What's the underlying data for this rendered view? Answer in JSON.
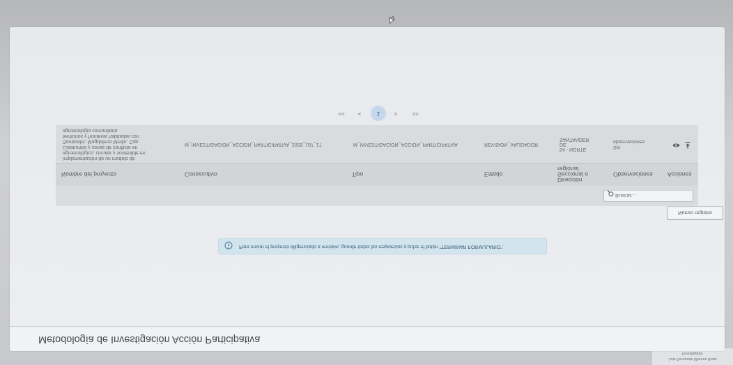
{
  "header": {
    "title": "Metodología de Investigación Acción Participativa"
  },
  "user_box": {
    "name": "Luis Fernando Moreno Arias",
    "role": "Investigador"
  },
  "alert": {
    "icon": "info-icon",
    "text": "Para enviar el proyecto diligenciado a revisión, guarde todas las respuestas y pulse el botón \"TERMINAR FORMULARIO\"."
  },
  "toolbar": {
    "new_record_label": "Nuevo registro",
    "search_icon": "search-icon",
    "search_placeholder": "Buscar..."
  },
  "table": {
    "columns": [
      "Nombre del proyecto",
      "Consecutivo",
      "Tipo",
      "Estado",
      "Dirección Seccional o regional",
      "Observaciones",
      "Acciones"
    ],
    "rows": [
      {
        "name_lines": [
          "Implementación de un modelo de",
          "agroecológico, circular y sostenible en",
          "Catatumbo y zonas de conflicto en",
          "Santander, Magdalena Medio, Cap.",
          "territorios y fronteras habitadas con",
          "agroecología comunitaria"
        ],
        "consecutivo": "M_INVESTIGACION_ACCION_PARTICIPATIVA_2025_107_17",
        "tipo": "M_INVESTIGACION_ACCION_PARTICIPATIVA",
        "estado": "REVISION_VALIDADOR",
        "direccion": "54 - NORTE DE SANTANDER",
        "observaciones": "Sin observaciones",
        "actions": [
          "eye-icon",
          "download-icon"
        ]
      }
    ]
  },
  "pagination": {
    "first": "<<",
    "prev": "<",
    "current": "1",
    "next": ">",
    "last": ">>"
  },
  "colors": {
    "alert_bg": "#d2e4ee",
    "alert_text": "#3d5d72",
    "current_page": "#c5d7ea",
    "panel_bg": "#d9dbde"
  }
}
